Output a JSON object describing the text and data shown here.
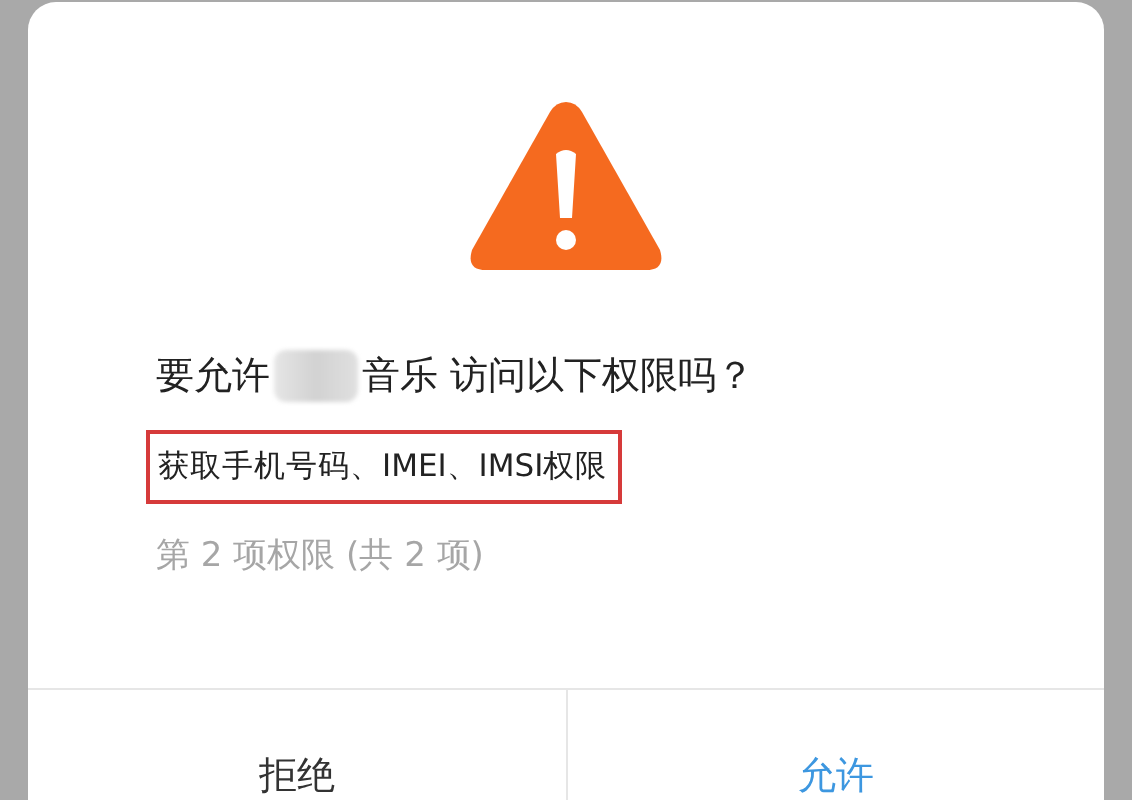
{
  "dialog": {
    "question_before": "要允许",
    "question_after": "音乐 访问以下权限吗？",
    "permission": "获取手机号码、IMEI、IMSI权限",
    "progress": "第 2 项权限 (共 2 项)",
    "buttons": [
      {
        "label": "拒绝",
        "kind": "cancel"
      },
      {
        "label": "允许",
        "kind": "confirm"
      }
    ]
  }
}
